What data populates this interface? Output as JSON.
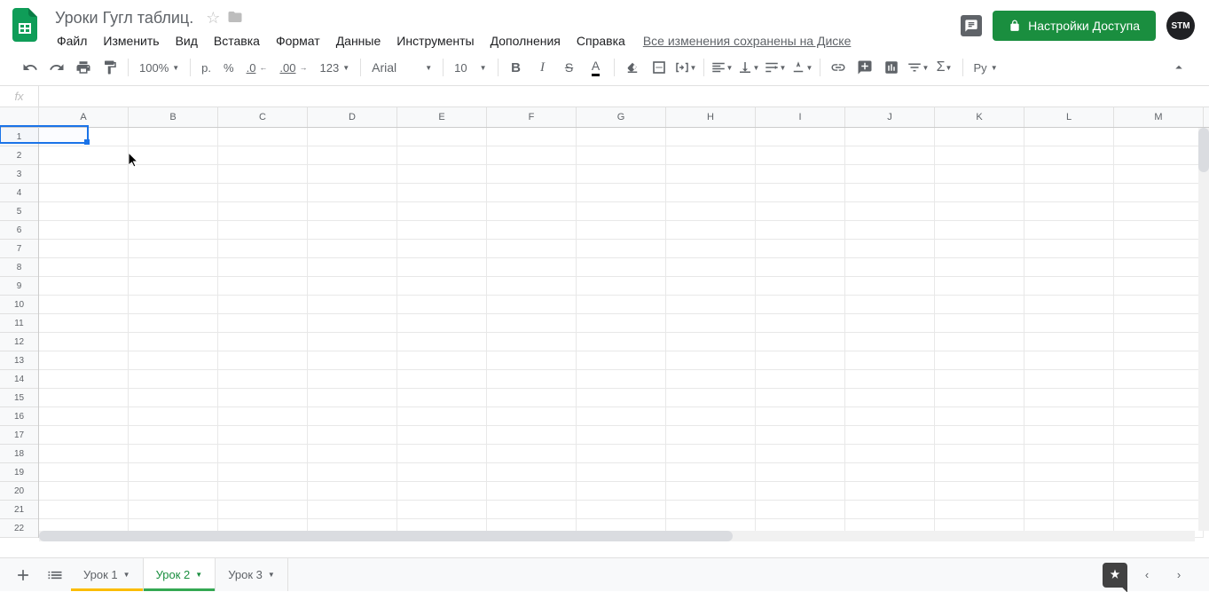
{
  "doc": {
    "title": "Уроки Гугл таблиц."
  },
  "menu": [
    "Файл",
    "Изменить",
    "Вид",
    "Вставка",
    "Формат",
    "Данные",
    "Инструменты",
    "Дополнения",
    "Справка"
  ],
  "save_status": "Все изменения сохранены на Диске",
  "share": {
    "label": "Настройки Доступа"
  },
  "avatar": "STM",
  "toolbar": {
    "zoom": "100%",
    "currency": "р.",
    "percent": "%",
    "dec_less": ".0",
    "dec_more": ".00",
    "more_formats": "123",
    "font": "Arial",
    "font_size": "10",
    "input_mode": "Ру"
  },
  "formula": {
    "fx": "fx",
    "value": ""
  },
  "columns": [
    "A",
    "B",
    "C",
    "D",
    "E",
    "F",
    "G",
    "H",
    "I",
    "J",
    "K",
    "L",
    "M"
  ],
  "rows": [
    "1",
    "2",
    "3",
    "4",
    "5",
    "6",
    "7",
    "8",
    "9",
    "10",
    "11",
    "12",
    "13",
    "14",
    "15",
    "16",
    "17",
    "18",
    "19",
    "20",
    "21",
    "22"
  ],
  "selected": {
    "col": 0,
    "row": 1
  },
  "sheets": [
    {
      "name": "Урок 1",
      "color": "#fbbc04",
      "active": false
    },
    {
      "name": "Урок 2",
      "color": "#34a853",
      "active": true
    },
    {
      "name": "Урок 3",
      "color": "",
      "active": false
    }
  ]
}
